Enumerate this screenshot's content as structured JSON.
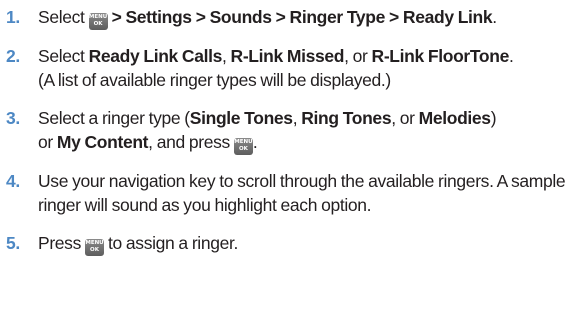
{
  "steps": [
    {
      "number": "1.",
      "select": "Select",
      "path": "> Settings > Sounds > Ringer Type > Ready Link",
      "end": "."
    },
    {
      "number": "2.",
      "select": "Select",
      "opt1": "Ready Link Calls",
      "sep1": ",",
      "opt2": "R-Link Missed",
      "sep2": ", or",
      "opt3": "R-Link FloorTone",
      "end": ".",
      "note": "(A list of available ringer types will be displayed.)"
    },
    {
      "number": "3.",
      "pre": "Select a ringer type (",
      "opt1": "Single Tones",
      "sep1": ",",
      "opt2": "Ring Tones",
      "sep2": ", or",
      "opt3": "Melodies",
      "post": ")",
      "or": "or",
      "opt4": "My Content",
      "press": ", and press",
      "end": "."
    },
    {
      "number": "4.",
      "text": "Use your navigation key to scroll through the available ringers. A sample ringer will sound as you highlight each option."
    },
    {
      "number": "5.",
      "press": "Press",
      "rest": "to assign a ringer."
    }
  ],
  "menu_key": {
    "icon": "menu-ok-key-icon",
    "top": "MENU",
    "bottom": "OK"
  }
}
